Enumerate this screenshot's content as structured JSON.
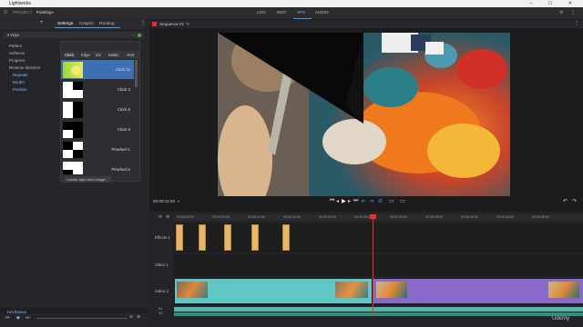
{
  "app": {
    "title": "Lightworks"
  },
  "topbar": {
    "project_label": "PROJECT",
    "project_name": "Painting",
    "modes": [
      "LOG",
      "EDIT",
      "VFX",
      "AUDIO"
    ],
    "active_mode": "VFX"
  },
  "left_tabs": {
    "add": "+",
    "settings": "Settings",
    "graphs": "Graphs",
    "routing": "Routing"
  },
  "effect": {
    "name": "Wipe",
    "props": {
      "pattern": "Pattern",
      "pattern_value": "Clock 12",
      "softness": "Softness",
      "progress": "Progress",
      "reverse": "Reverse direction",
      "repeats": "Repeats",
      "border": "Border",
      "position": "Position"
    }
  },
  "preset_tabs": [
    "Clock",
    "Edge",
    "Iris",
    "Matrix",
    "Vest"
  ],
  "presets": [
    "Clock 12",
    "Clock 3",
    "Clock 6",
    "Clock 9",
    "Pinwheel 1",
    "Pinwheel 2"
  ],
  "create_button": "Create wipe from image...",
  "keyframes_label": "Keyframes",
  "viewer": {
    "title": "Sequence #1",
    "timecode": "00:00:11:03"
  },
  "ruler_ticks": [
    "00:00:00:00",
    "00:00:05:00",
    "00:00:10:00",
    "00:00:15:00",
    "00:00:20:00",
    "00:00:25:00",
    "00:00:30:00",
    "00:00:35:00",
    "00:00:40:00",
    "00:00:45:00",
    "00:00:50:00"
  ],
  "tracks": {
    "effects": "Effects 1",
    "video1": "Video 1",
    "video2": "Video 2",
    "audio": "A1",
    "audio2": "A2"
  },
  "watermark": "Udemy",
  "colors": {
    "accent": "#3aa0ff",
    "playhead": "#ff2a2a",
    "clip_teal": "#5fc8c4",
    "clip_purple": "#8a6ac8",
    "effect_clip": "#e8b56a",
    "preset_selected": "#3c6fb4"
  }
}
